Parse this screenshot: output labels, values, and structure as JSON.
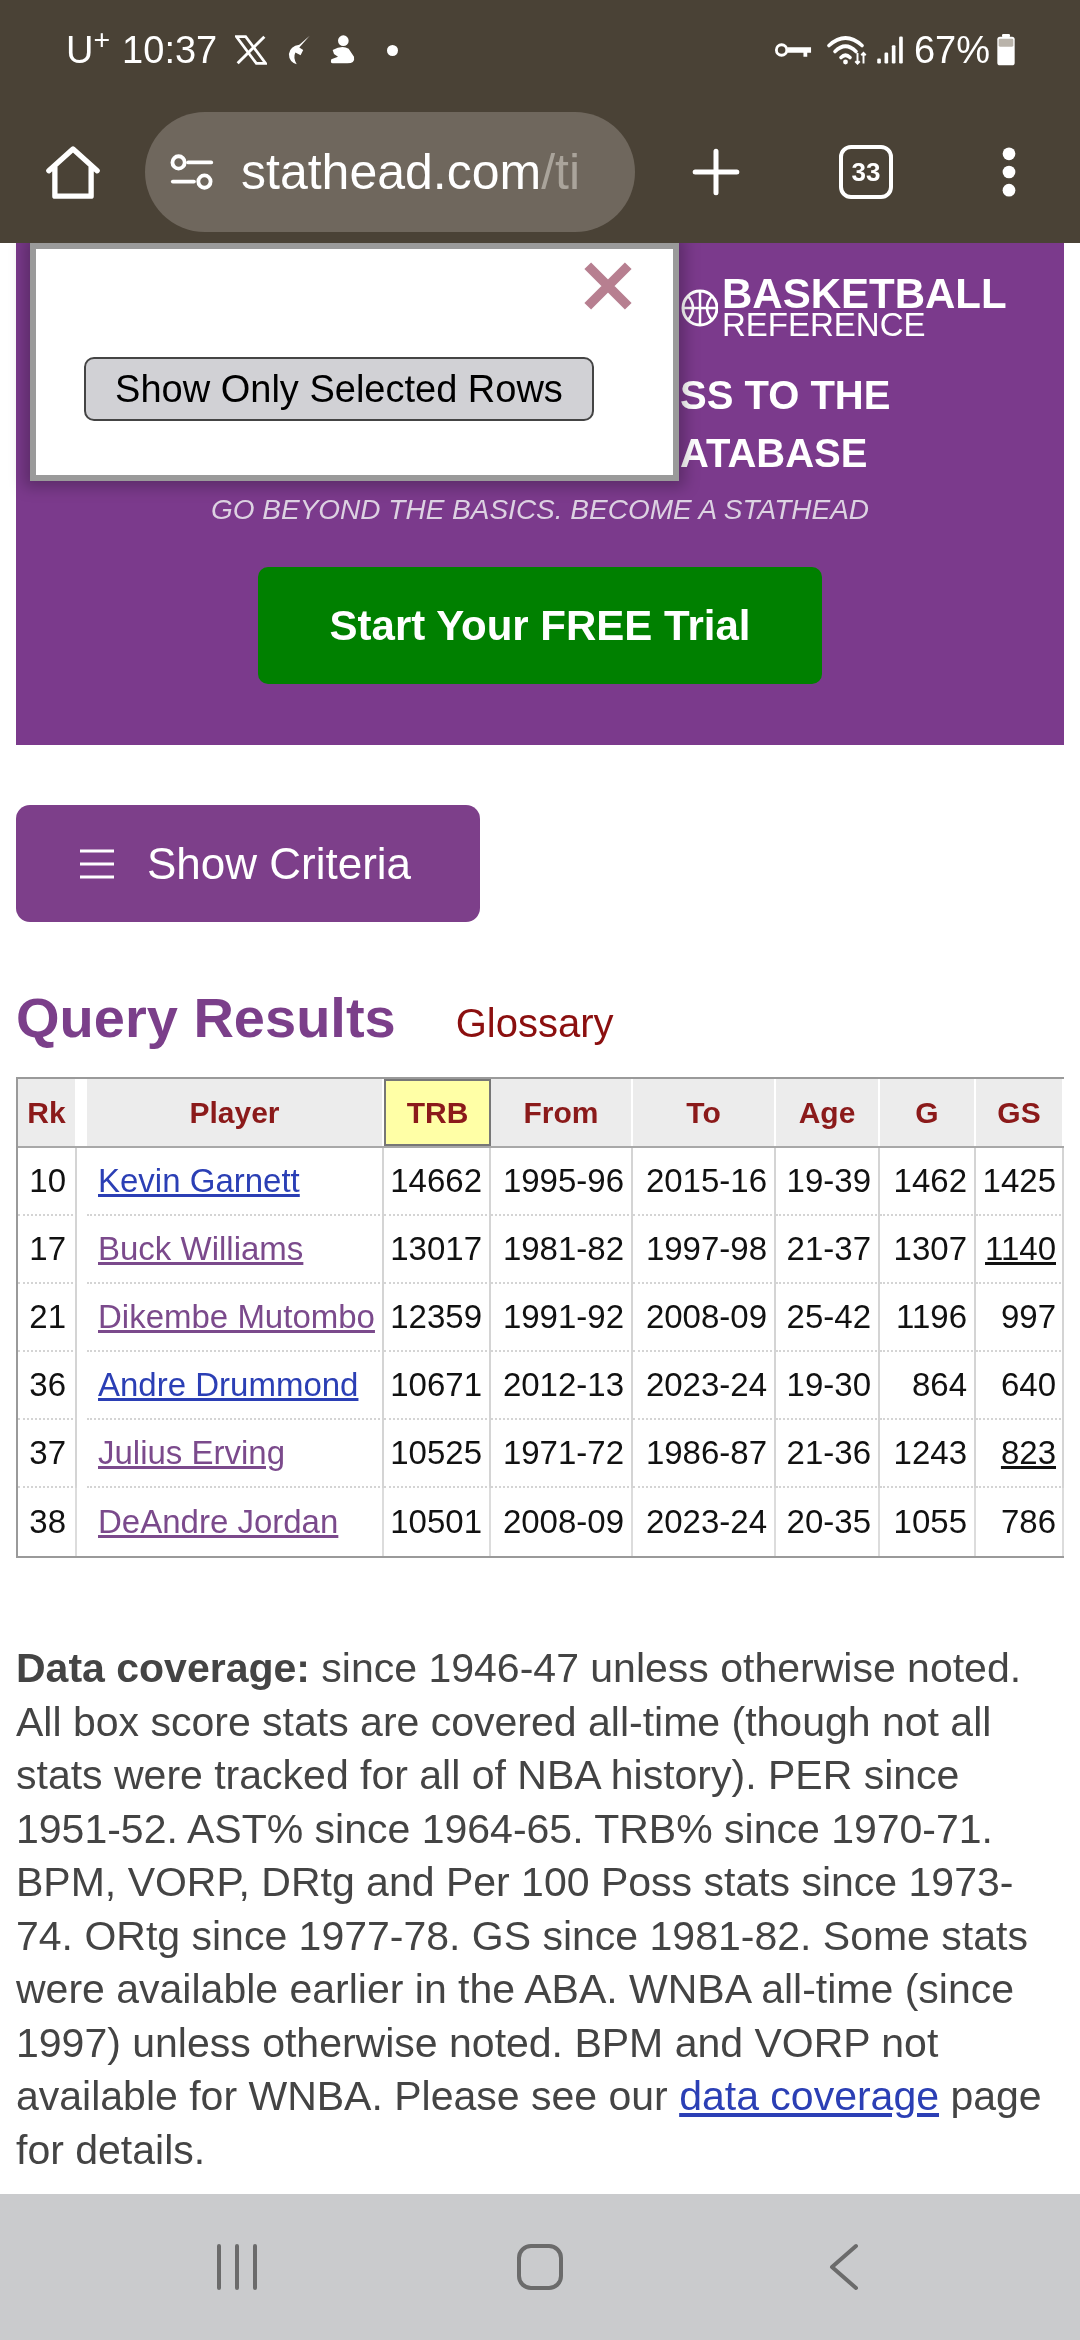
{
  "status_bar": {
    "carrier": "U$^{+}$",
    "time": "10:37",
    "battery": "67%"
  },
  "browser": {
    "url_host": "stathead.com",
    "url_path": "/ti",
    "tab_count": "33"
  },
  "popup": {
    "button": "Show Only Selected Rows"
  },
  "banner": {
    "logo_title": "BASKETBALL",
    "logo_subtitle": "REFERENCE",
    "headline_lines": [
      "SS TO THE",
      "ATABASE"
    ],
    "tagline": "GO BEYOND THE BASICS. BECOME A STATHEAD",
    "cta": "Start Your FREE Trial"
  },
  "criteria_button": "Show Criteria",
  "results": {
    "title": "Query Results",
    "glossary_link": "Glossary"
  },
  "table": {
    "columns": [
      {
        "label": "Rk",
        "sorted": false
      },
      {
        "label": "Player",
        "sorted": false
      },
      {
        "label": "TRB",
        "sorted": true
      },
      {
        "label": "From",
        "sorted": false
      },
      {
        "label": "To",
        "sorted": false
      },
      {
        "label": "Age",
        "sorted": false
      },
      {
        "label": "G",
        "sorted": false
      },
      {
        "label": "GS",
        "sorted": false
      }
    ],
    "rows": [
      {
        "rk": "10",
        "player": {
          "name": "Kevin Garnett",
          "visited": false
        },
        "trb": "14662",
        "from": "1995-96",
        "to": "2015-16",
        "age": "19-39",
        "g": "1462",
        "gs": {
          "value": "1425",
          "underlined": false
        }
      },
      {
        "rk": "17",
        "player": {
          "name": "Buck Williams",
          "visited": true
        },
        "trb": "13017",
        "from": "1981-82",
        "to": "1997-98",
        "age": "21-37",
        "g": "1307",
        "gs": {
          "value": "1140",
          "underlined": true
        }
      },
      {
        "rk": "21",
        "player": {
          "name": "Dikembe Mutombo",
          "visited": true
        },
        "trb": "12359",
        "from": "1991-92",
        "to": "2008-09",
        "age": "25-42",
        "g": "1196",
        "gs": {
          "value": "997",
          "underlined": false
        }
      },
      {
        "rk": "36",
        "player": {
          "name": "Andre Drummond",
          "visited": false
        },
        "trb": "10671",
        "from": "2012-13",
        "to": "2023-24",
        "age": "19-30",
        "g": "864",
        "gs": {
          "value": "640",
          "underlined": false
        }
      },
      {
        "rk": "37",
        "player": {
          "name": "Julius Erving",
          "visited": true
        },
        "trb": "10525",
        "from": "1971-72",
        "to": "1986-87",
        "age": "21-36",
        "g": "1243",
        "gs": {
          "value": "823",
          "underlined": true
        }
      },
      {
        "rk": "38",
        "player": {
          "name": "DeAndre Jordan",
          "visited": true
        },
        "trb": "10501",
        "from": "2008-09",
        "to": "2023-24",
        "age": "20-35",
        "g": "1055",
        "gs": {
          "value": "786",
          "underlined": false
        }
      }
    ]
  },
  "note": {
    "text": "**Data coverage:** since 1946-47 unless otherwise noted. All box score stats are covered all-time (though not all stats were tracked for all of NBA history). PER since 1951-52. AST% since 1964-65. TRB% since 1970-71. BPM, VORP, DRtg and Per 100 Poss stats since 1973-74. ORtg since 1977-78. GS since 1981-82. Some stats were available earlier in the ABA. WNBA all-time (since 1997) unless otherwise noted. BPM and VORP not available for WNBA. Please see our",
    "link": "data coverage",
    "text_end": "page for details."
  }
}
